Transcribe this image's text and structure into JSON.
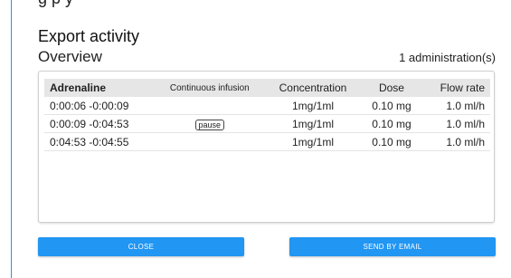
{
  "header": {
    "cut_text": "g       p       y"
  },
  "dialog": {
    "title": "Export activity",
    "overview_title": "Overview",
    "admin_count": "1 administration(s)"
  },
  "table": {
    "columns": [
      "Adrenaline",
      "Continuous infusion",
      "Concentration",
      "Dose",
      "Flow rate"
    ],
    "rows": [
      {
        "time": "0:00:06 -0:00:09",
        "mode": "",
        "concentration": "1mg/1ml",
        "dose": "0.10 mg",
        "flow_rate": "1.0 ml/h"
      },
      {
        "time": "0:00:09 -0:04:53",
        "mode": "pause",
        "concentration": "1mg/1ml",
        "dose": "0.10 mg",
        "flow_rate": "1.0 ml/h"
      },
      {
        "time": "0:04:53 -0:04:55",
        "mode": "",
        "concentration": "1mg/1ml",
        "dose": "0.10 mg",
        "flow_rate": "1.0 ml/h"
      }
    ]
  },
  "actions": {
    "close_label": "CLOSE",
    "email_label": "SEND BY EMAIL"
  },
  "colors": {
    "accent": "#2196f3",
    "header_row": "#e6e6e6"
  }
}
